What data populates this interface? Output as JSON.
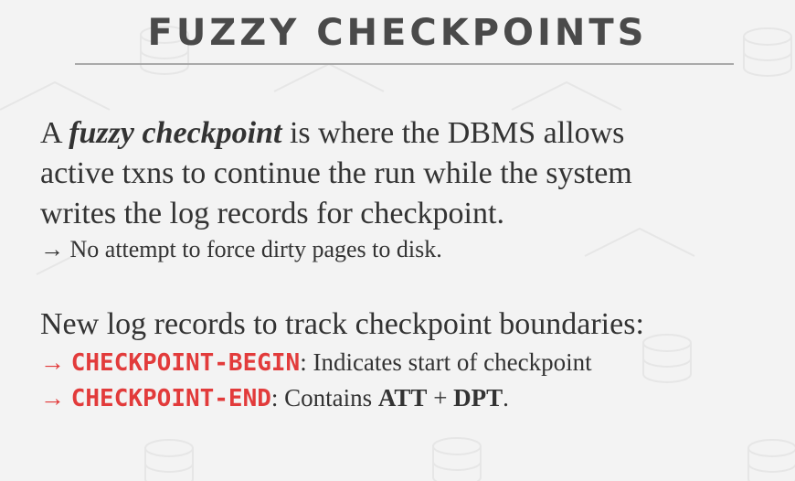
{
  "title": "FUZZY CHECKPOINTS",
  "paragraph": {
    "prefix": "A ",
    "emphasis": "fuzzy checkpoint",
    "suffix": " is where the DBMS allows",
    "line2": "active txns to continue the run while the system",
    "line3": "writes the log records for checkpoint.",
    "bullet": "No attempt to force dirty pages to disk."
  },
  "section2": {
    "heading": "New log records to track checkpoint boundaries:",
    "items": [
      {
        "code": "CHECKPOINT-BEGIN",
        "text": ": Indicates start of checkpoint"
      },
      {
        "code": "CHECKPOINT-END",
        "text_before": ": Contains ",
        "bold1": "ATT",
        "mid": " + ",
        "bold2": "DPT",
        "end": "."
      }
    ]
  },
  "arrow": "→",
  "colors": {
    "accent": "#e23b3b",
    "text": "#333333",
    "title": "#4a4a4a",
    "background": "#f3f3f3"
  },
  "icons": [
    "database-icon"
  ]
}
